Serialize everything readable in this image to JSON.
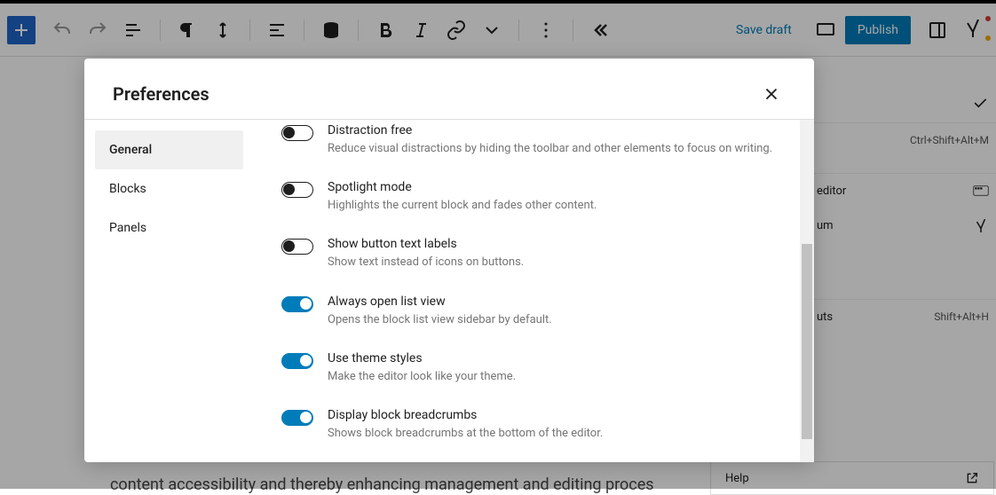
{
  "toolbar": {
    "save_draft": "Save draft",
    "publish": "Publish"
  },
  "modal": {
    "title": "Preferences",
    "tabs": {
      "general": "General",
      "blocks": "Blocks",
      "panels": "Panels"
    },
    "prefs": [
      {
        "label": "Distraction free",
        "desc": "Reduce visual distractions by hiding the toolbar and other elements to focus on writing.",
        "on": false
      },
      {
        "label": "Spotlight mode",
        "desc": "Highlights the current block and fades other content.",
        "on": false
      },
      {
        "label": "Show button text labels",
        "desc": "Show text instead of icons on buttons.",
        "on": false
      },
      {
        "label": "Always open list view",
        "desc": "Opens the block list view sidebar by default.",
        "on": true
      },
      {
        "label": "Use theme styles",
        "desc": "Make the editor look like your theme.",
        "on": true
      },
      {
        "label": "Display block breadcrumbs",
        "desc": "Shows block breadcrumbs at the bottom of the editor.",
        "on": true
      }
    ]
  },
  "right_panel": {
    "editor": "editor",
    "um": "um",
    "uts": "uts",
    "kbd1": "Ctrl+Shift+Alt+M",
    "kbd2": "Shift+Alt+H",
    "help": "Help"
  },
  "bg_text": "content accessibility and thereby enhancing management and editing proces"
}
